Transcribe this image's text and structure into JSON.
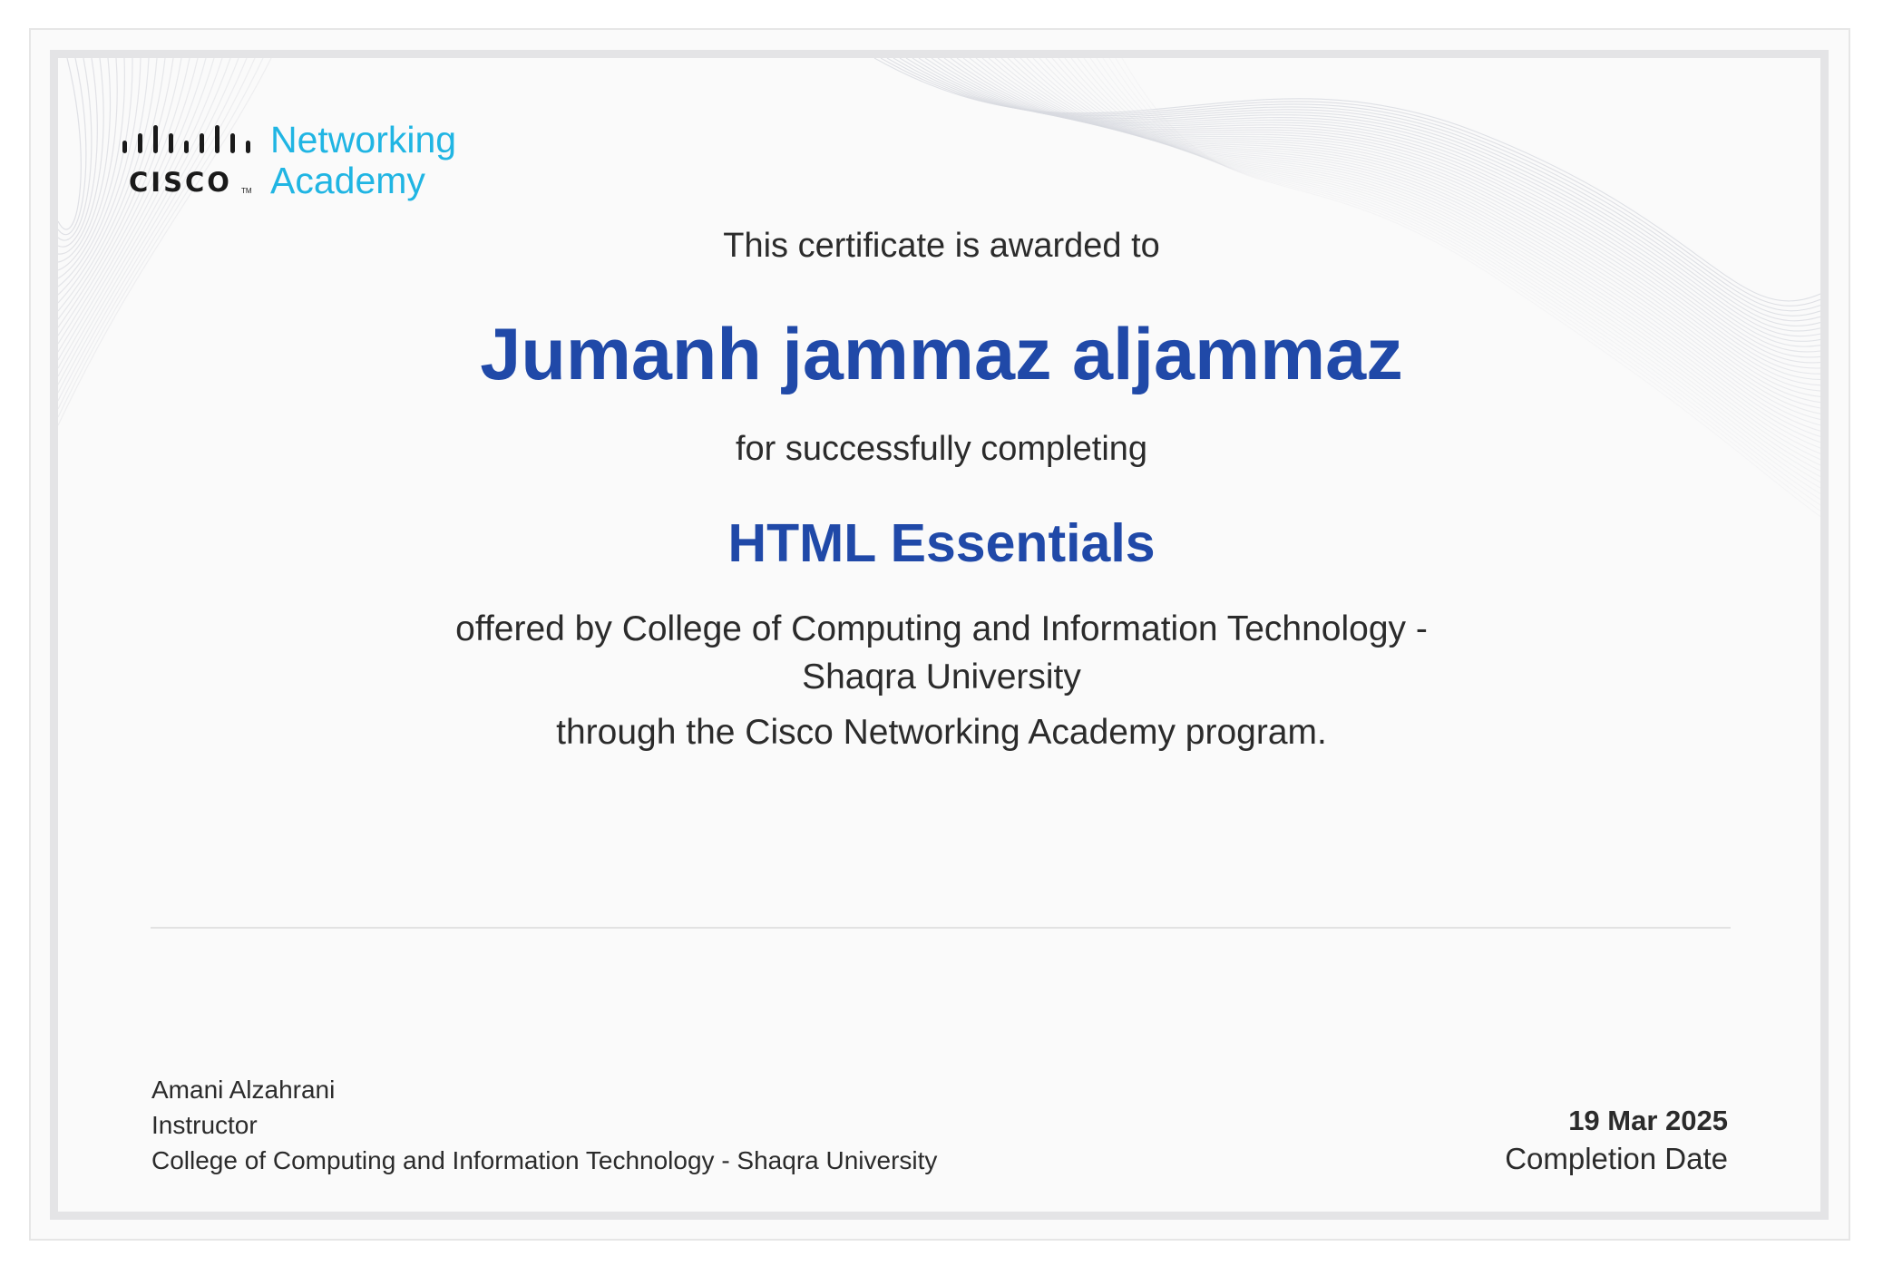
{
  "logo": {
    "company": "CISCO",
    "networking": "Networking",
    "academy": "Academy",
    "trademark": "TM"
  },
  "certificate": {
    "awarded_text": "This certificate is awarded to",
    "recipient": "Jumanh jammaz aljammaz",
    "completing_text": "for successfully completing",
    "course": "HTML Essentials",
    "offered_line1": "offered by College of Computing and Information Technology -",
    "offered_line2": "Shaqra University",
    "program_text": "through the Cisco Networking Academy program."
  },
  "signature": {
    "name": "Amani Alzahrani",
    "role": "Instructor",
    "organization": "College of Computing and Information Technology - Shaqra University"
  },
  "completion": {
    "date": "19 Mar 2025",
    "label": "Completion Date"
  },
  "colors": {
    "accent_blue": "#2049a8",
    "cisco_cyan": "#20b5e3",
    "text": "#2b2b2b"
  }
}
